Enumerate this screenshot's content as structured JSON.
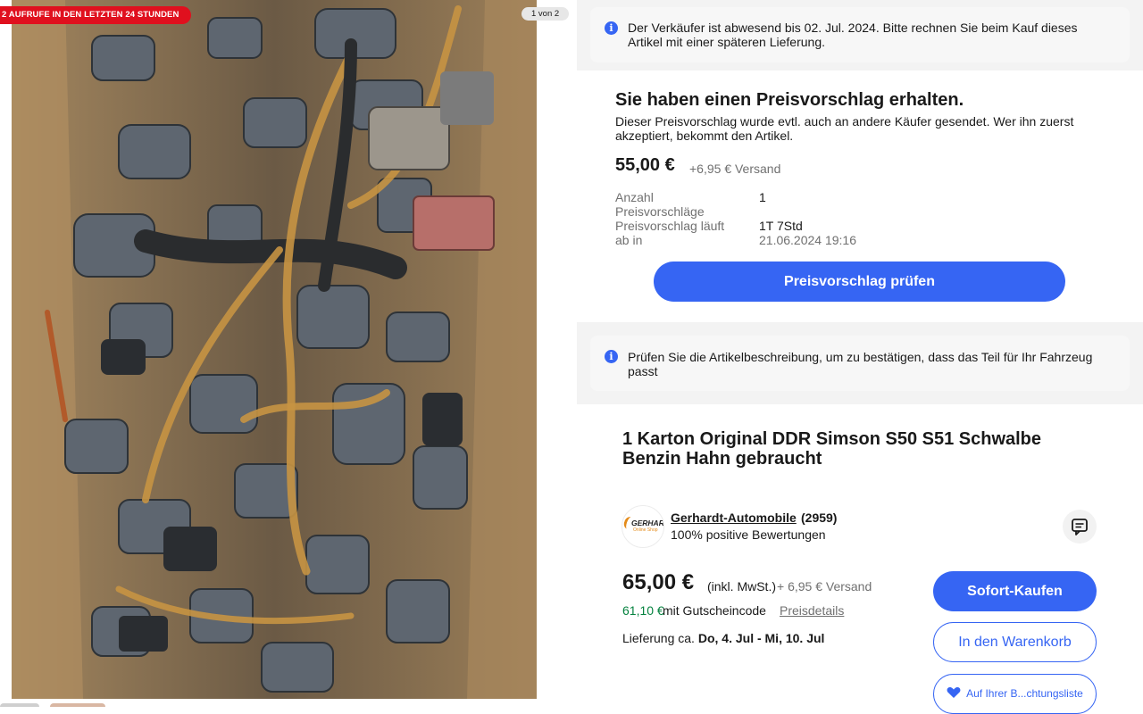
{
  "gallery": {
    "views_badge": "2 AUFRUFE IN DEN LETZTEN 24 STUNDEN",
    "image_counter": "1 von 2"
  },
  "seller_away_notice": {
    "icon": "info-icon",
    "text": "Der Verkäufer ist abwesend bis 02. Jul. 2024. Bitte rechnen Sie beim Kauf dieses Artikel mit einer späteren Lieferung."
  },
  "offer": {
    "title": "Sie haben einen Preisvorschlag erhalten.",
    "subtitle": "Dieser Preisvorschlag wurde evtl. auch an andere Käufer gesendet. Wer ihn zuerst akzeptiert, bekommt den Artikel.",
    "price": "55,00 €",
    "shipping": "+6,95 € Versand",
    "count_label": "Anzahl Preisvorschläge",
    "count_value": "1",
    "expiry_label_line1": "Preisvorschlag läuft",
    "expiry_label_line2": "ab in",
    "expiry_value": "1T 7Std",
    "expiry_date": "21.06.2024 19:16",
    "button_label": "Preisvorschlag prüfen"
  },
  "fitment_notice": {
    "icon": "info-icon",
    "text": "Prüfen Sie die Artikelbeschreibung, um zu bestätigen, dass das Teil für Ihr Fahrzeug passt"
  },
  "listing": {
    "title": "1 Karton Original DDR Simson S50 S51 Schwalbe Benzin Hahn gebraucht",
    "seller": {
      "logo_text": "GERHAR",
      "logo_subtext": "Online Shop",
      "name": "Gerhardt-Automobile",
      "rating_count": "(2959)",
      "feedback": "100% positive Bewertungen"
    },
    "price": "65,00 €",
    "tax_note": "(inkl. MwSt.)",
    "shipping": "+ 6,95 € Versand",
    "coupon_price": "61,10 €",
    "coupon_text": "mit Gutscheincode",
    "price_details_link": "Preisdetails",
    "delivery_prefix": "Lieferung ca.",
    "delivery_dates": "Do, 4. Jul - Mi, 10. Jul",
    "buy_now_label": "Sofort-Kaufen",
    "add_to_cart_label": "In den Warenkorb",
    "watchlist_label": "Auf Ihrer B...chtungsliste"
  },
  "colors": {
    "primary_blue": "#3665f3",
    "badge_red": "#e0101e",
    "coupon_green": "#05823f",
    "watch_heart": "#3665f3"
  }
}
